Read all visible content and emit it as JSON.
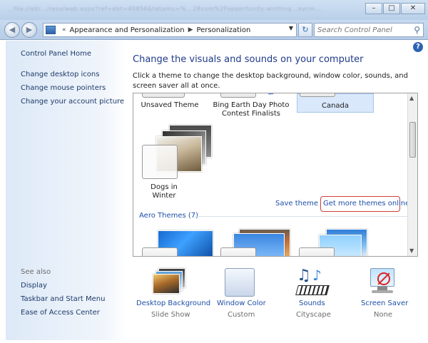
{
  "titlebar": {
    "blurred_path": "...file://ebi.../resv/web.aspx?ref=ebt=40856&tetamu=%...2Rvsm%2Fopportunity-writting...xvcm..."
  },
  "nav": {
    "back_glyph": "◀",
    "forward_glyph": "▶",
    "crumb_marker": "«",
    "breadcrumb": [
      "Appearance and Personalization",
      "Personalization"
    ],
    "search_placeholder": "Search Control Panel"
  },
  "sidebar": {
    "home": "Control Panel Home",
    "links": [
      "Change desktop icons",
      "Change mouse pointers",
      "Change your account picture"
    ],
    "see_also_label": "See also",
    "see_also": [
      "Display",
      "Taskbar and Start Menu",
      "Ease of Access Center"
    ]
  },
  "main": {
    "heading": "Change the visuals and sounds on your computer",
    "description": "Click a theme to change the desktop background, window color, sounds, and screen saver all at once.",
    "themes": {
      "my_themes": [
        {
          "label": "Unsaved Theme"
        },
        {
          "label": "Bing Earth Day Photo Contest Finalists"
        },
        {
          "label": "Canada",
          "selected": true
        },
        {
          "label": "Dogs in Winter"
        }
      ],
      "save_theme": "Save theme",
      "get_more": "Get more themes online",
      "aero_title": "Aero Themes (7)"
    }
  },
  "options": [
    {
      "title": "Desktop Background",
      "sub": "Slide Show"
    },
    {
      "title": "Window Color",
      "sub": "Custom"
    },
    {
      "title": "Sounds",
      "sub": "Cityscape"
    },
    {
      "title": "Screen Saver",
      "sub": "None"
    }
  ]
}
